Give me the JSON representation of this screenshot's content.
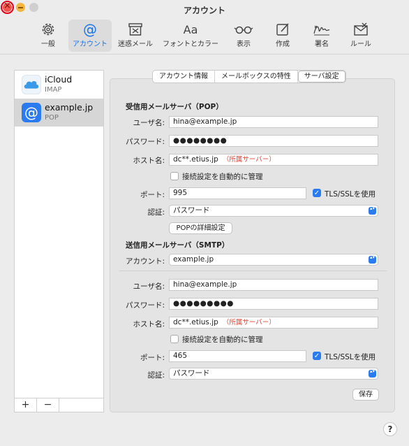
{
  "window": {
    "title": "アカウント"
  },
  "toolbar": {
    "items": [
      {
        "label": "一般",
        "icon": "gear-icon"
      },
      {
        "label": "アカウント",
        "icon": "at-icon"
      },
      {
        "label": "迷惑メール",
        "icon": "junk-mail-icon"
      },
      {
        "label": "フォントとカラー",
        "icon": "font-icon"
      },
      {
        "label": "表示",
        "icon": "glasses-icon"
      },
      {
        "label": "作成",
        "icon": "compose-icon"
      },
      {
        "label": "署名",
        "icon": "signature-icon"
      },
      {
        "label": "ルール",
        "icon": "rules-icon"
      }
    ],
    "font_glyph": "Aa"
  },
  "accounts": [
    {
      "name": "iCloud",
      "type": "IMAP",
      "icon": "icloud-icon"
    },
    {
      "name": "example.jp",
      "type": "POP",
      "icon": "at-icon"
    }
  ],
  "list_footer": {
    "add": "+",
    "remove": "−"
  },
  "tabs": [
    "アカウント情報",
    "メールボックスの特性",
    "サーバ設定"
  ],
  "incoming": {
    "title": "受信用メールサーバ（POP）",
    "username_label": "ユーザ名:",
    "username": "hina@example.jp",
    "password_label": "パスワード:",
    "password": "●●●●●●●●",
    "host_label": "ホスト名:",
    "host": "dc**.etius.jp",
    "host_note": "（所属サーバー）",
    "auto_manage_label": "接続設定を自動的に管理",
    "port_label": "ポート:",
    "port": "995",
    "tls_label": "TLS/SSLを使用",
    "auth_label": "認証:",
    "auth_value": "パスワード",
    "advanced_button": "POPの詳細設定"
  },
  "outgoing": {
    "title": "送信用メールサーバ（SMTP）",
    "account_label": "アカウント:",
    "account_value": "example.jp",
    "username_label": "ユーザ名:",
    "username": "hina@example.jp",
    "password_label": "パスワード:",
    "password": "●●●●●●●●●",
    "host_label": "ホスト名:",
    "host": "dc**.etius.jp",
    "host_note": "（所属サーバー）",
    "auto_manage_label": "接続設定を自動的に管理",
    "port_label": "ポート:",
    "port": "465",
    "tls_label": "TLS/SSLを使用",
    "auth_label": "認証:",
    "auth_value": "パスワード"
  },
  "save_button": "保存",
  "help": "?",
  "check_glyph": "✓",
  "select_arrow_glyph": "▴▾"
}
